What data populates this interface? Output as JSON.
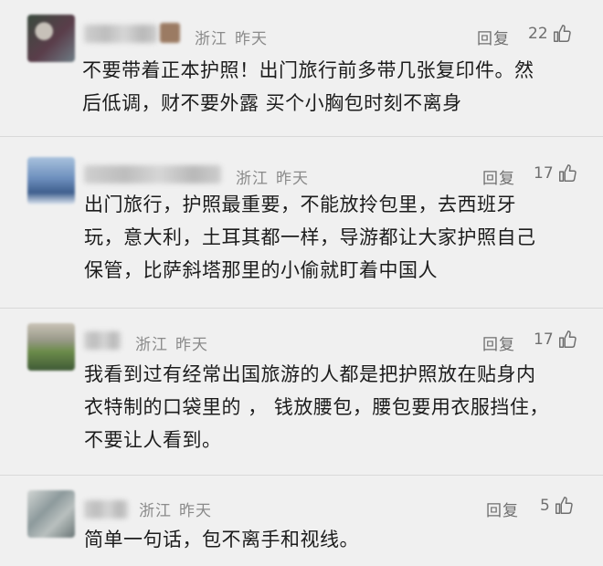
{
  "comments": [
    {
      "region": "浙江",
      "time": "昨天",
      "reply_label": "回复",
      "likes": "22",
      "lines": [
        "不要带着正本护照！出门旅行前多带几张复印件。然",
        "后低调，财不要外露 买个小胸包时刻不离身"
      ],
      "avatar_colors": [
        "#3a4a3e",
        "#5a3d4a",
        "#c7c1b9",
        "#6e7d86"
      ]
    },
    {
      "region": "浙江",
      "time": "昨天",
      "reply_label": "回复",
      "likes": "17",
      "lines": [
        "出门旅行，护照最重要，不能放拎包里，去西班牙",
        "玩，意大利，土耳其都一样，导游都让大家护照自己",
        "保管，比萨斜塔那里的小偷就盯着中国人"
      ],
      "avatar_colors": [
        "#6d8fbd",
        "#a9c2dd",
        "#3f5f8e",
        "#dfe7f0"
      ]
    },
    {
      "region": "浙江",
      "time": "昨天",
      "reply_label": "回复",
      "likes": "17",
      "lines": [
        "我看到过有经常出国旅游的人都是把护照放在贴身内",
        "衣特制的口袋里的 ， 钱放腰包，腰包要用衣服挡住，",
        "不要让人看到。"
      ],
      "avatar_colors": [
        "#6b8b4a",
        "#9a9a8a",
        "#3f5a36",
        "#c9c3b6"
      ]
    },
    {
      "region": "浙江",
      "time": "昨天",
      "reply_label": "回复",
      "likes": "5",
      "lines": [
        "简单一句话，包不离手和视线。"
      ],
      "avatar_colors": [
        "#8d9a9c",
        "#b9c0bf",
        "#6a7676",
        "#d2d6d4"
      ]
    }
  ]
}
